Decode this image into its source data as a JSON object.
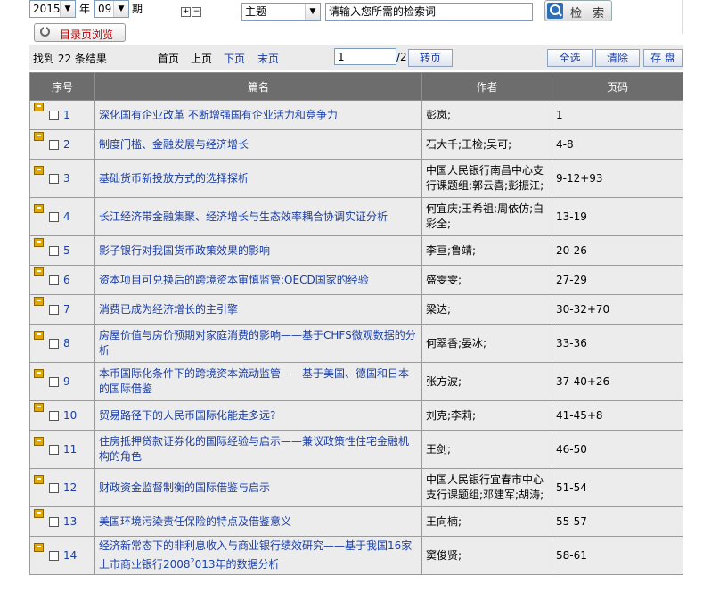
{
  "filters": {
    "year": "2015",
    "year_label": "年",
    "issue": "09",
    "issue_label": "期",
    "field": "主题",
    "search_placeholder": "请输入您所需的检索词",
    "search_button": "检 索",
    "tree_expand": "+",
    "tree_collapse": "−"
  },
  "catalog_button": "目录页浏览",
  "results_bar": {
    "found_text": "找到 22 条结果",
    "first_page": "首页",
    "prev_page": "上页",
    "next_page": "下页",
    "last_page": "末页",
    "page_value": "1",
    "page_total": "/2",
    "go_button": "转页",
    "select_all": "全选",
    "clear": "清除",
    "save": "存 盘"
  },
  "table": {
    "headers": [
      "序号",
      "篇名",
      "作者",
      "页码"
    ],
    "rows": [
      {
        "no": "1",
        "title": "深化国有企业改革 不断增强国有企业活力和竞争力",
        "author": "彭岚;",
        "pages": "1"
      },
      {
        "no": "2",
        "title": "制度门槛、金融发展与经济增长",
        "author": "石大千;王检;吴可;",
        "pages": "4-8"
      },
      {
        "no": "3",
        "title": "基础货币新投放方式的选择探析",
        "author": "中国人民银行南昌中心支行课题组;郭云喜;彭振江;",
        "pages": "9-12+93"
      },
      {
        "no": "4",
        "title": "长江经济带金融集聚、经济增长与生态效率耦合协调实证分析",
        "author": "何宜庆;王希祖;周依仿;白彩全;",
        "pages": "13-19"
      },
      {
        "no": "5",
        "title": "影子银行对我国货币政策效果的影响",
        "author": "李亘;鲁靖;",
        "pages": "20-26"
      },
      {
        "no": "6",
        "title": "资本项目可兑换后的跨境资本审慎监管:OECD国家的经验",
        "author": "盛雯雯;",
        "pages": "27-29"
      },
      {
        "no": "7",
        "title": "消费已成为经济增长的主引擎",
        "author": "梁达;",
        "pages": "30-32+70"
      },
      {
        "no": "8",
        "title": "房屋价值与房价预期对家庭消费的影响——基于CHFS微观数据的分析",
        "author": "何翠香;晏冰;",
        "pages": "33-36"
      },
      {
        "no": "9",
        "title": "本币国际化条件下的跨境资本流动监管——基于美国、德国和日本的国际借鉴",
        "author": "张方波;",
        "pages": "37-40+26"
      },
      {
        "no": "10",
        "title": "贸易路径下的人民币国际化能走多远?",
        "author": "刘克;李莉;",
        "pages": "41-45+8"
      },
      {
        "no": "11",
        "title": "住房抵押贷款证券化的国际经验与启示——兼议政策性住宅金融机构的角色",
        "author": "王剑;",
        "pages": "46-50"
      },
      {
        "no": "12",
        "title": "财政资金监督制衡的国际借鉴与启示",
        "author": "中国人民银行宜春市中心支行课题组;邓建军;胡涛;",
        "pages": "51-54"
      },
      {
        "no": "13",
        "title": "美国环境污染责任保险的特点及借鉴意义",
        "author": "王向楠;",
        "pages": "55-57"
      },
      {
        "no": "14",
        "title_pre": "经济新常态下的非利息收入与商业银行绩效研究——基于我国16家上市商业银行2008",
        "title_sup": "2",
        "title_post": "013年的数据分析",
        "author": "窦俊贤;",
        "pages": "58-61"
      }
    ]
  }
}
